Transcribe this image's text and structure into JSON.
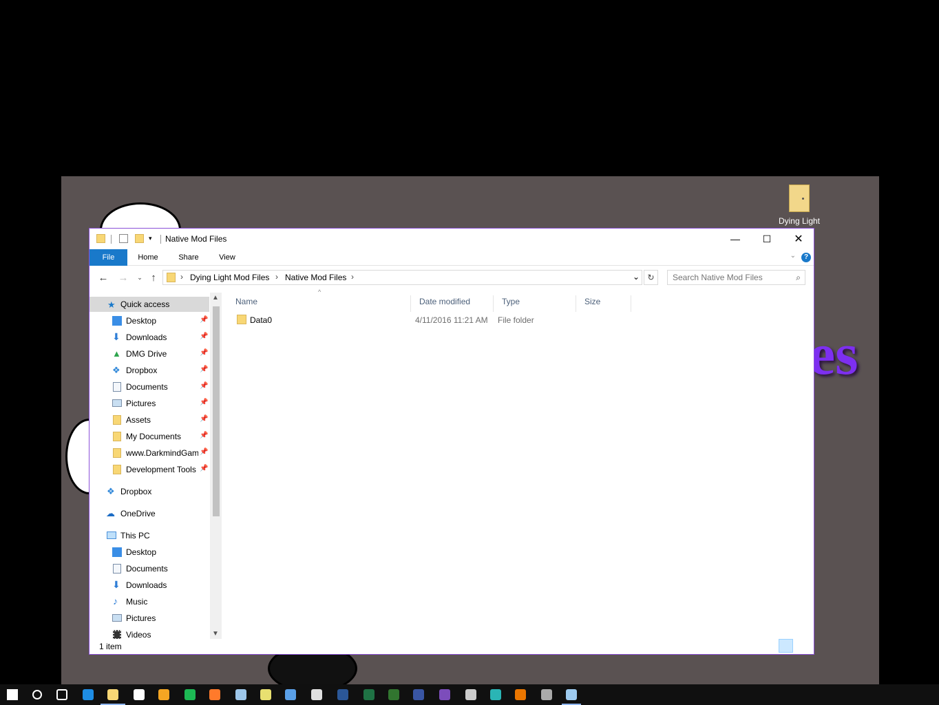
{
  "window": {
    "title": "Native Mod Files",
    "accent": "#1979ca"
  },
  "ribbon": {
    "tabs": [
      "File",
      "Home",
      "Share",
      "View"
    ]
  },
  "address": {
    "crumbs": [
      "Dying Light Mod Files",
      "Native Mod Files"
    ]
  },
  "search": {
    "placeholder": "Search Native Mod Files"
  },
  "nav": {
    "quick_access": "Quick access",
    "pinned": [
      "Desktop",
      "Downloads",
      "DMG Drive",
      "Dropbox",
      "Documents",
      "Pictures",
      "Assets",
      "My Documents",
      "www.DarkmindGames",
      "Development Tools"
    ],
    "dropbox": "Dropbox",
    "onedrive": "OneDrive",
    "this_pc": "This PC",
    "pc_items": [
      "Desktop",
      "Documents",
      "Downloads",
      "Music",
      "Pictures",
      "Videos"
    ]
  },
  "columns": [
    "Name",
    "Date modified",
    "Type",
    "Size"
  ],
  "files": [
    {
      "name": "Data0",
      "date": "4/11/2016 11:21 AM",
      "type": "File folder",
      "size": ""
    }
  ],
  "status": {
    "count": "1 item"
  },
  "desktop": {
    "icon_label": "Dying Light",
    "icon_label2": "s",
    "wallpaper_text": "es",
    "wallpaper_text_color": "#7d2ff0"
  },
  "taskbar": {
    "icons": [
      "windows-start-icon",
      "cortana-icon",
      "task-view-icon",
      "edge-icon",
      "file-explorer-icon",
      "store-icon",
      "media-player-icon",
      "spotify-icon",
      "firefox-icon",
      "notepad-icon",
      "notes-icon",
      "paint-icon",
      "app-icon",
      "word-icon",
      "excel-icon",
      "project-icon",
      "visio-icon",
      "visual-studio-icon",
      "unity-icon",
      "terminal-icon",
      "blender-icon",
      "gimp-icon",
      "steam-icon"
    ]
  }
}
